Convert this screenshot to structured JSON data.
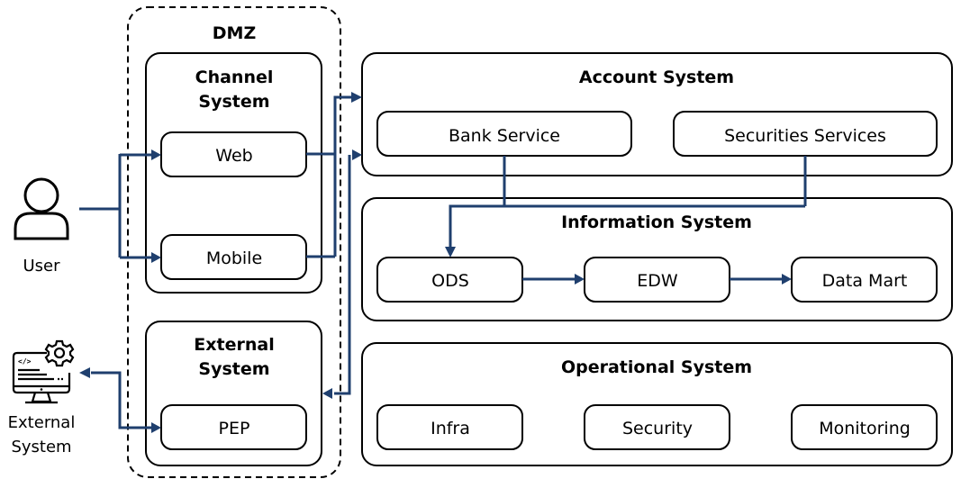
{
  "diagram": {
    "actors": {
      "user": {
        "label": "User",
        "icon": "user-icon"
      },
      "external_system": {
        "label_line1": "External",
        "label_line2": "System",
        "icon": "monitor-code-gear-icon"
      }
    },
    "dmz": {
      "title": "DMZ",
      "channel_system": {
        "title_line1": "Channel",
        "title_line2": "System",
        "items": [
          "Web",
          "Mobile"
        ]
      },
      "external_system": {
        "title_line1": "External",
        "title_line2": "System",
        "items": [
          "PEP"
        ]
      }
    },
    "account_system": {
      "title": "Account System",
      "items": [
        "Bank Service",
        "Securities Services"
      ]
    },
    "information_system": {
      "title": "Information System",
      "items": [
        "ODS",
        "EDW",
        "Data Mart"
      ]
    },
    "operational_system": {
      "title": "Operational System",
      "items": [
        "Infra",
        "Security",
        "Monitoring"
      ]
    },
    "colors": {
      "connector": "#1f3f6e",
      "border": "#000000",
      "background": "#ffffff"
    },
    "connections": [
      {
        "from": "User",
        "to": "Web"
      },
      {
        "from": "User",
        "to": "Mobile"
      },
      {
        "from": "Web",
        "to": "Account System"
      },
      {
        "from": "Mobile",
        "to": "Account System"
      },
      {
        "from": "Account System",
        "to": "External System (DMZ)"
      },
      {
        "from": "PEP",
        "to": "External System",
        "bidirectional": true
      },
      {
        "from": "Bank Service",
        "to": "ODS"
      },
      {
        "from": "Securities Services",
        "to": "ODS"
      },
      {
        "from": "ODS",
        "to": "EDW"
      },
      {
        "from": "EDW",
        "to": "Data Mart"
      }
    ]
  }
}
